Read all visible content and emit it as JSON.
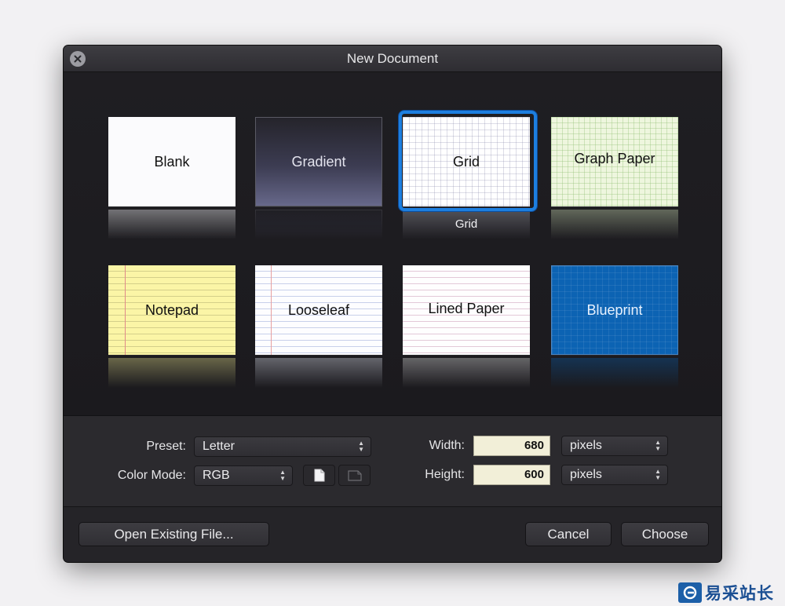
{
  "dialog": {
    "title": "New Document"
  },
  "templates": [
    {
      "label": "Blank"
    },
    {
      "label": "Gradient"
    },
    {
      "label": "Grid",
      "caption": "Grid",
      "selected": true
    },
    {
      "label": "Graph Paper"
    },
    {
      "label": "Notepad"
    },
    {
      "label": "Looseleaf"
    },
    {
      "label": "Lined Paper"
    },
    {
      "label": "Blueprint"
    }
  ],
  "settings": {
    "preset_label": "Preset:",
    "preset_value": "Letter",
    "color_mode_label": "Color Mode:",
    "color_mode_value": "RGB",
    "width_label": "Width:",
    "width_value": "680",
    "width_unit": "pixels",
    "height_label": "Height:",
    "height_value": "600",
    "height_unit": "pixels"
  },
  "footer": {
    "open_existing_label": "Open Existing File...",
    "cancel_label": "Cancel",
    "choose_label": "Choose"
  },
  "watermark": {
    "text": "易采站长站"
  },
  "colors": {
    "selection_accent": "#1d7fe0",
    "dialog_background": "#1f1e21"
  },
  "icons": [
    "close-icon",
    "portrait-orientation-icon",
    "landscape-orientation-icon",
    "updown-arrows-icon"
  ]
}
